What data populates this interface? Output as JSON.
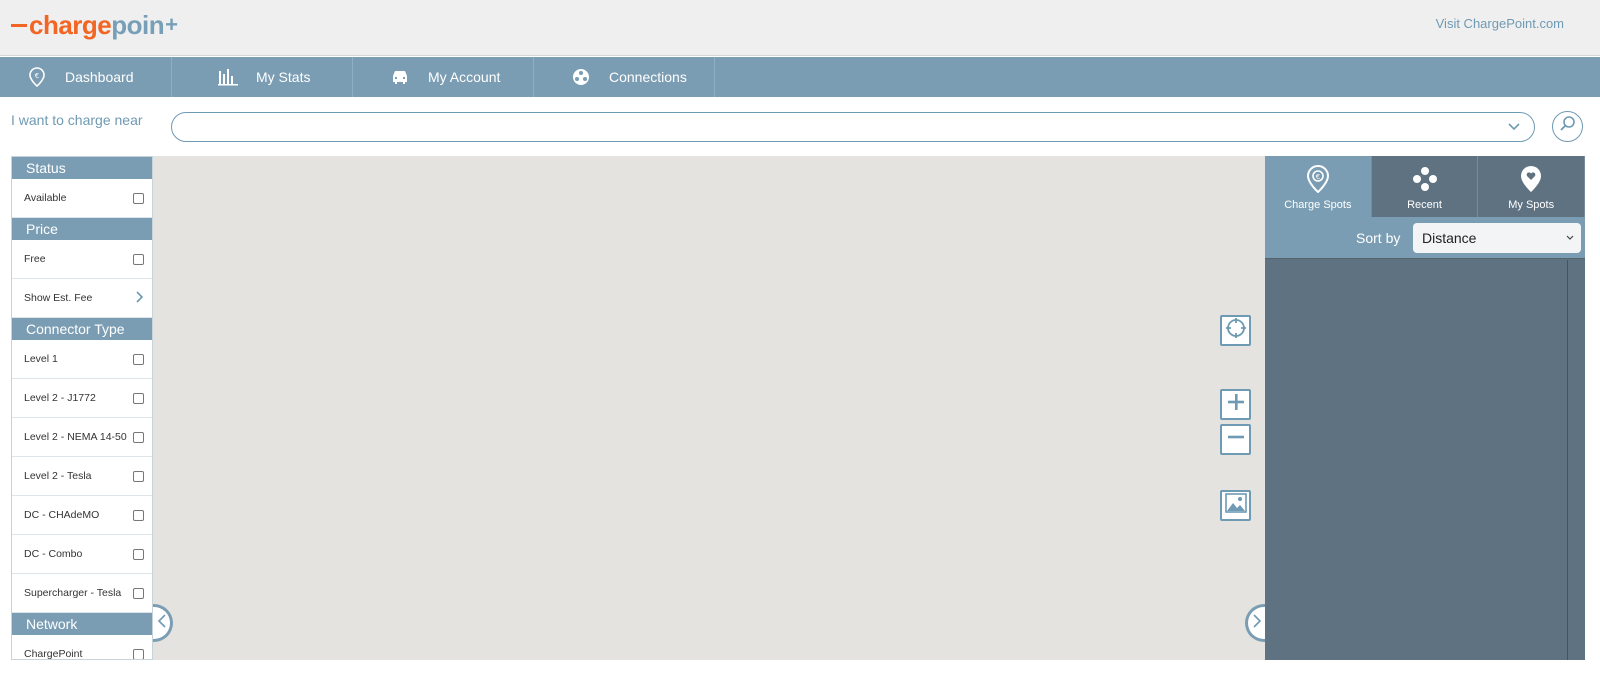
{
  "header": {
    "logo": {
      "charge": "charge",
      "point": "poin",
      "plus": "+"
    },
    "visit_link": "Visit ChargePoint.com"
  },
  "nav": {
    "items": [
      {
        "label": "Dashboard",
        "icon": "dashboard-pin-icon"
      },
      {
        "label": "My Stats",
        "icon": "bar-chart-icon"
      },
      {
        "label": "My Account",
        "icon": "car-icon"
      },
      {
        "label": "Connections",
        "icon": "connections-icon"
      }
    ]
  },
  "search": {
    "label": "I want to charge near",
    "value": "",
    "placeholder": ""
  },
  "filters": {
    "status": {
      "title": "Status",
      "items": [
        {
          "label": "Available",
          "checked": false
        }
      ]
    },
    "price": {
      "title": "Price",
      "items": [
        {
          "label": "Free",
          "checked": false
        },
        {
          "label": "Show Est. Fee"
        }
      ]
    },
    "connector": {
      "title": "Connector Type",
      "items": [
        {
          "label": "Level 1"
        },
        {
          "label": "Level 2 - J1772"
        },
        {
          "label": "Level 2 - NEMA 14-50"
        },
        {
          "label": "Level 2 - Tesla"
        },
        {
          "label": "DC - CHAdeMO"
        },
        {
          "label": "DC - Combo"
        },
        {
          "label": "Supercharger - Tesla"
        }
      ]
    },
    "network": {
      "title": "Network",
      "items": [
        {
          "label": "ChargePoint"
        }
      ]
    }
  },
  "map_controls": {
    "locate": "crosshair-icon",
    "zoom_in": "plus-icon",
    "zoom_out": "minus-icon",
    "layers": "image-icon"
  },
  "right_panel": {
    "tabs": [
      {
        "label": "Charge Spots",
        "active": true
      },
      {
        "label": "Recent",
        "active": false
      },
      {
        "label": "My Spots",
        "active": false
      }
    ],
    "sort": {
      "label": "Sort by",
      "value": "Distance"
    }
  },
  "colors": {
    "brand_orange": "#f26522",
    "brand_blue": "#7a9db3",
    "panel_dark": "#5f7282",
    "map_bg": "#e4e3df"
  }
}
